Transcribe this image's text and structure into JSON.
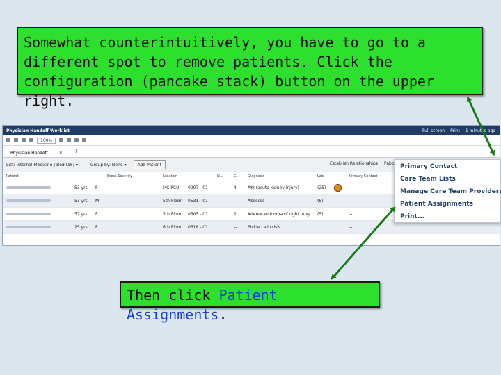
{
  "callouts": {
    "top": "Somewhat counterintuitively, you have to go to a different spot to remove patients.  Click the configuration (pancake stack) button on the upper right.",
    "bottom_prefix": "Then click ",
    "bottom_link": "Patient Assignments",
    "bottom_suffix": "."
  },
  "app": {
    "title": "Physician Handoff Worklist",
    "full_screen": "Full screen",
    "print": "Print",
    "time": "1 minutes ago",
    "zoom": "100%",
    "tab_label": "Physician Handoff",
    "tab_close": "×",
    "tab_add": "+",
    "filter": {
      "list_label": "List:",
      "list_value": "Internal Medicine | Bed (16)",
      "group_label": "Group by:",
      "group_value": "None",
      "add_patient": "Add Patient",
      "establish": "Establish Relationships",
      "pabo": "Pabo"
    },
    "headers": [
      "Patient",
      "",
      "",
      "Illness Severity",
      "Location",
      "",
      "N...",
      "C...",
      "Diagnosis",
      "Lab",
      "",
      "Primary Contact"
    ],
    "rows": [
      {
        "age": "53 yrs",
        "sex": "F",
        "sev": "",
        "loc": "MC PCU",
        "bed": "0907 - 01",
        "na": "",
        "cnt": "4",
        "dx": "AKI (acute kidney injury)",
        "code": "(25)",
        "pc": "--"
      },
      {
        "age": "53 yrs",
        "sex": "M",
        "sev": "--",
        "loc": "5th Floor",
        "bed": "0531 - 01",
        "na": "--",
        "cnt": "",
        "dx": "Abscess",
        "code": "(6)",
        "pc": ""
      },
      {
        "age": "57 yrs",
        "sex": "F",
        "sev": "",
        "loc": "5th Floor",
        "bed": "0505 - 01",
        "na": "",
        "cnt": "2",
        "dx": "Adenocarcinoma of right lung",
        "code": "(5)",
        "pc": "--"
      },
      {
        "age": "25 yrs",
        "sex": "F",
        "sev": "",
        "loc": "6th Floor",
        "bed": "0618 - 01",
        "na": "",
        "cnt": "--",
        "dx": "Sickle cell crisis",
        "code": "",
        "pc": "--"
      }
    ]
  },
  "menu": {
    "items": [
      "Primary Contact",
      "Care Team Lists",
      "Manage Care Team Providers",
      "Patient Assignments",
      "Print..."
    ]
  },
  "colors": {
    "callout_green": "#2ee02e",
    "titlebar": "#1e3c66",
    "menu_text": "#1f3f66",
    "arrow": "#1a7a1a"
  }
}
